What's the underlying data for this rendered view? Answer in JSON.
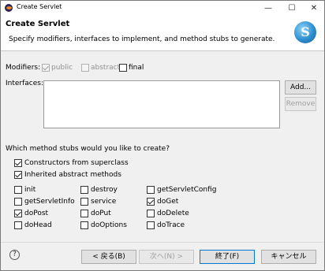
{
  "window": {
    "title": "Create Servlet",
    "minimize_glyph": "—",
    "maximize_glyph": "☐",
    "close_glyph": "✕"
  },
  "banner": {
    "title": "Create Servlet",
    "description": "Specify modifiers, interfaces to implement, and method stubs to generate.",
    "logo_letter": "S"
  },
  "modifiers": {
    "label": "Modifiers:",
    "options": [
      {
        "label": "public",
        "checked": true,
        "enabled": false
      },
      {
        "label": "abstract",
        "checked": false,
        "enabled": false
      },
      {
        "label": "final",
        "checked": false,
        "enabled": true
      }
    ]
  },
  "interfaces": {
    "label": "Interfaces:",
    "items": [],
    "add_label": "Add...",
    "remove_label": "Remove"
  },
  "stubs": {
    "question": "Which method stubs would you like to create?",
    "constructors": {
      "label": "Constructors from superclass",
      "checked": true
    },
    "inherited": {
      "label": "Inherited abstract methods",
      "checked": true
    },
    "methods": [
      {
        "label": "init",
        "checked": false
      },
      {
        "label": "destroy",
        "checked": false
      },
      {
        "label": "getServletConfig",
        "checked": false
      },
      {
        "label": "getServletInfo",
        "checked": false
      },
      {
        "label": "service",
        "checked": false
      },
      {
        "label": "doGet",
        "checked": true
      },
      {
        "label": "doPost",
        "checked": true
      },
      {
        "label": "doPut",
        "checked": false
      },
      {
        "label": "doDelete",
        "checked": false
      },
      {
        "label": "doHead",
        "checked": false
      },
      {
        "label": "doOptions",
        "checked": false
      },
      {
        "label": "doTrace",
        "checked": false
      }
    ]
  },
  "footer": {
    "help_glyph": "?",
    "back_label": "< 戻る(B)",
    "next_label": "次へ(N) >",
    "finish_label": "終了(F)",
    "cancel_label": "キャンセル"
  },
  "colors": {
    "accent": "#0078d7",
    "dialog_bg": "#f0f0f0",
    "banner_bg": "#ffffff"
  }
}
